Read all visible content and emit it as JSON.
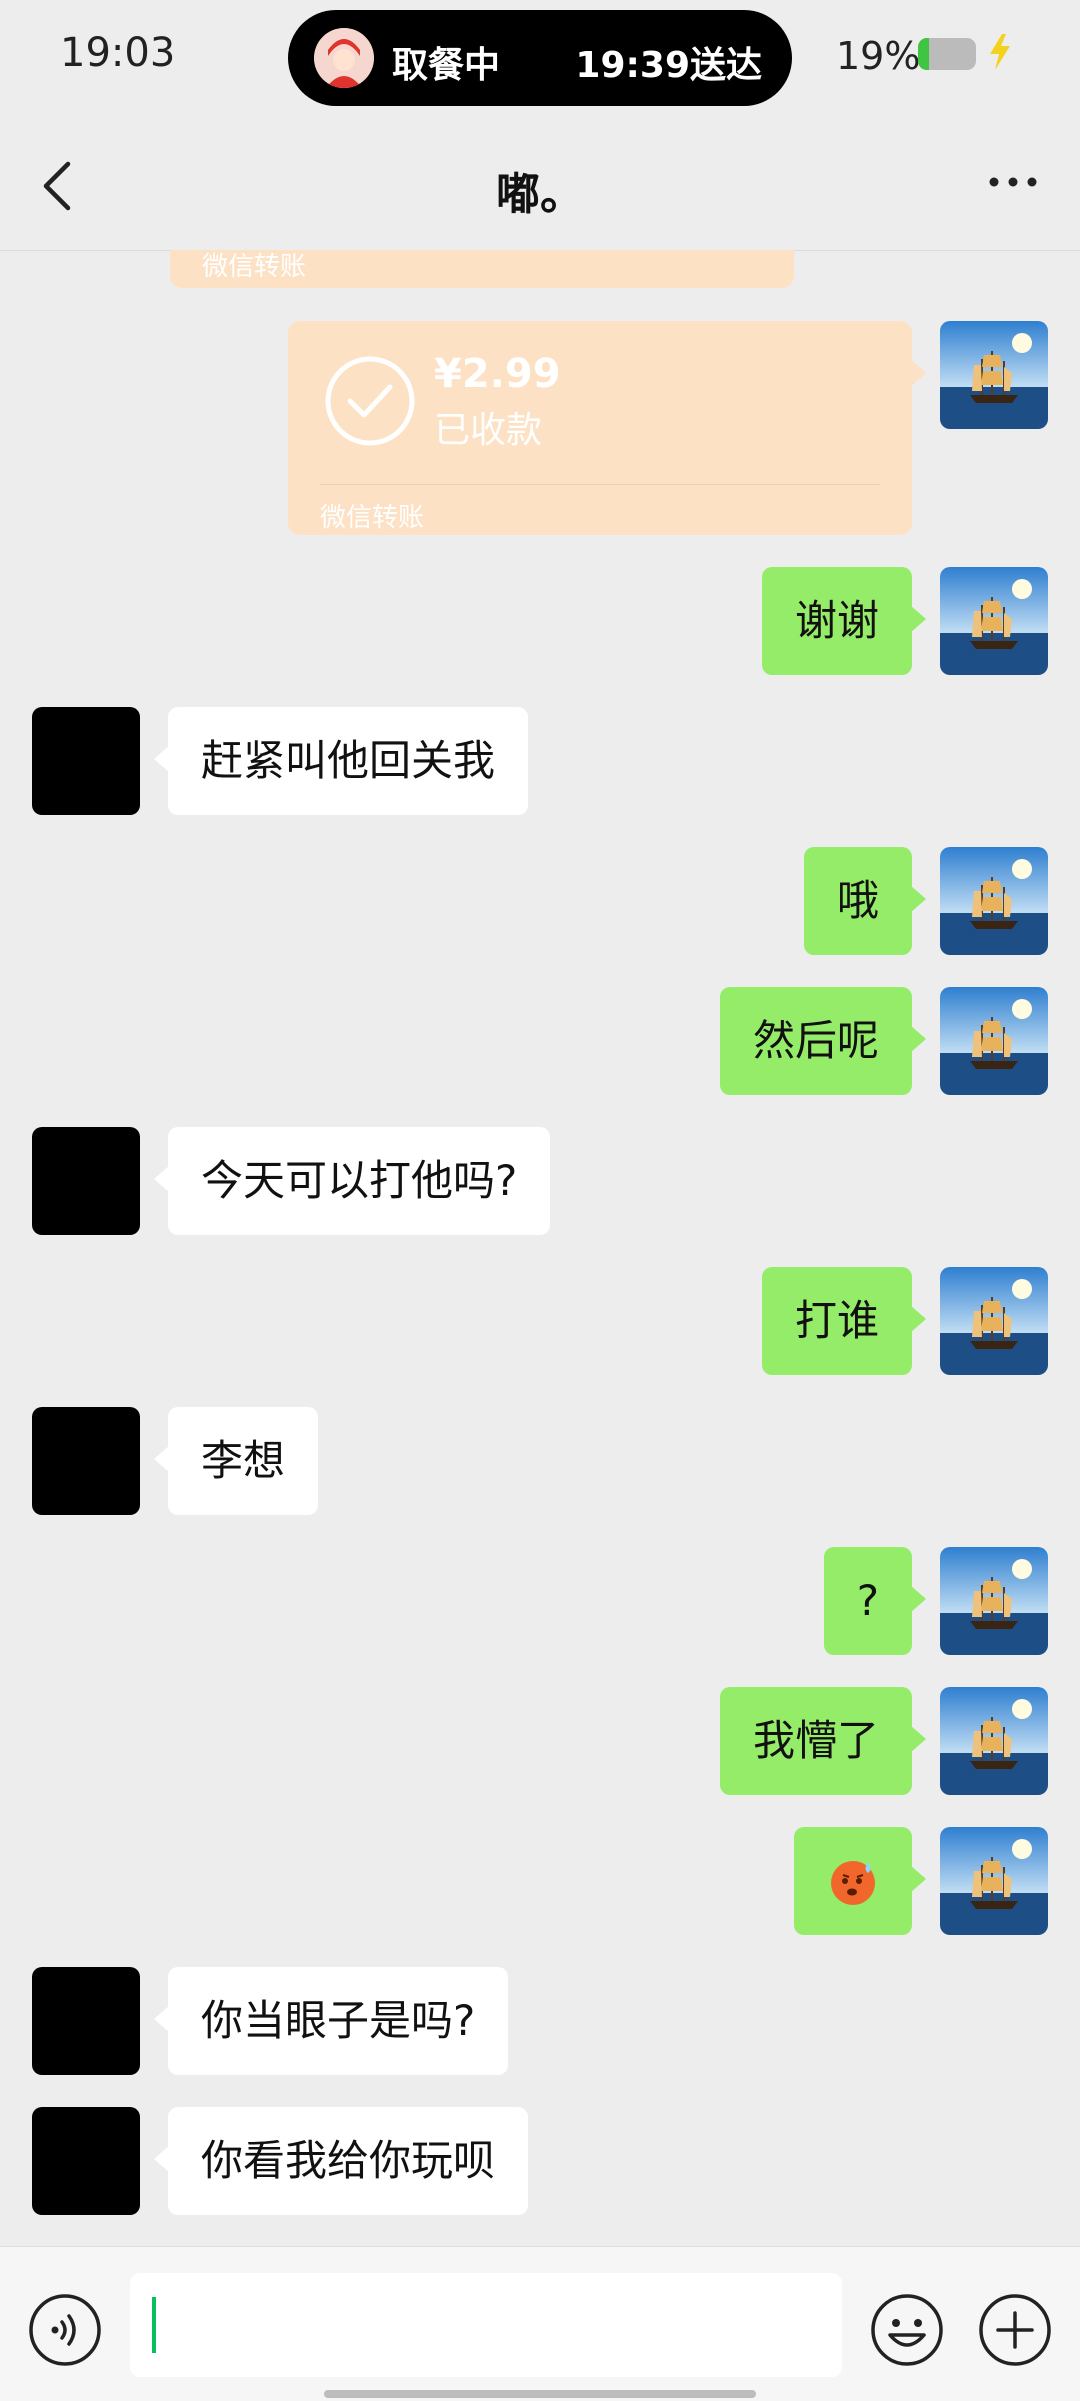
{
  "status_bar": {
    "time": "19:03",
    "island_status": "取餐中",
    "island_eta": "19:39送达",
    "battery_percent": "19%",
    "battery_level": 0.19,
    "charging": true
  },
  "navbar": {
    "back_icon": "chevron-left-icon",
    "title": "嘟。",
    "more_icon": "more-dots-icon"
  },
  "messages": {
    "transfer_top": {
      "foot": "微信转账"
    },
    "transfer": {
      "amount": "¥2.99",
      "status": "已收款",
      "foot": "微信转账",
      "icon": "check-circle-icon"
    },
    "m1": "谢谢",
    "m2": "赶紧叫他回关我",
    "m3": "哦",
    "m4": "然后呢",
    "m5": "今天可以打他吗?",
    "m6": "打谁",
    "m7": "李想",
    "m8": "?",
    "m9": "我懵了",
    "m10_icon": "sweat-face-emoji-icon",
    "m11": "你当眼子是吗?",
    "m12": "你看我给你玩呗"
  },
  "input_bar": {
    "voice_icon": "voice-input-icon",
    "text_value": "",
    "emoji_icon": "smiley-icon",
    "plus_icon": "plus-circle-icon"
  },
  "colors": {
    "background": "#ededed",
    "outgoing_bubble": "#95ec69",
    "incoming_bubble": "#ffffff",
    "transfer_card": "#fde1c4",
    "caret": "#07c160"
  }
}
